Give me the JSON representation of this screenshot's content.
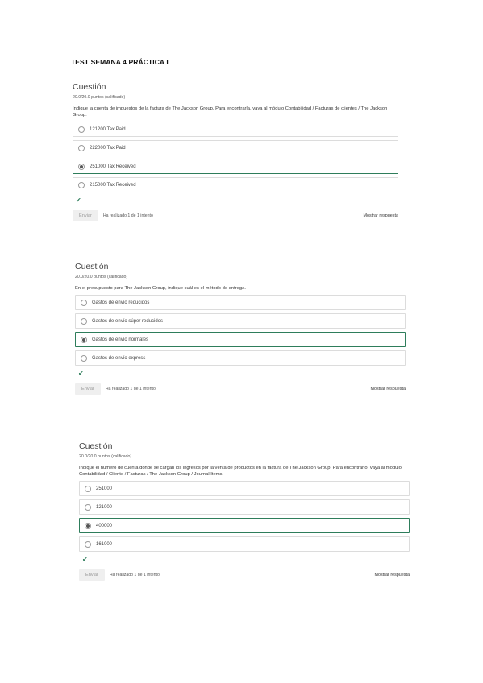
{
  "title": "TEST SEMANA 4 PRÁCTICA I",
  "questions": [
    {
      "heading": "Cuestión",
      "points": "20.0/20.0 puntos (calificado)",
      "text": "Indique la cuenta de impuestos de la factura de The Jackson Group. Para encontrarla, vaya al módulo Contabilidad / Facturas de clientes / The Jackson Group.",
      "options": [
        "121200 Tax Paid",
        "222000 Tax Paid",
        "251000 Tax Received",
        "215000 Tax Received"
      ],
      "selected_index": 2,
      "check": "✔",
      "submit": "Enviar",
      "attempts": "Ha realizado 1 de 1 intento",
      "show_answer": "Mostrar respuesta"
    },
    {
      "heading": "Cuestión",
      "points": "20.0/20.0 puntos (calificado)",
      "text": "En el presupuesto para The Jackson Group, indique cuál es el método de entrega.",
      "options": [
        "Gastos de envío reducidos",
        "Gastos de envío súper reducidos",
        "Gastos de envío normales",
        "Gastos de envío express"
      ],
      "selected_index": 2,
      "check": "✔",
      "submit": "Enviar",
      "attempts": "Ha realizado 1 de 1 intento",
      "show_answer": "Mostrar respuesta"
    },
    {
      "heading": "Cuestión",
      "points": "20.0/20.0 puntos (calificado)",
      "text": "Indique el número de cuenta donde se cargan los ingresos por la venta de productos en la factura de The Jackson Group. Para encontrarlo, vaya al módulo Contabilidad / Cliente / Facturas / The Jackson Group / Journal Items.",
      "options": [
        "251000",
        "121000",
        "400000",
        "161000"
      ],
      "selected_index": 2,
      "check": "✔",
      "submit": "Enviar",
      "attempts": "Ha realizado 1 de 1 intento",
      "show_answer": "Mostrar respuesta"
    }
  ],
  "colors": {
    "accent": "#2e7d5b"
  }
}
